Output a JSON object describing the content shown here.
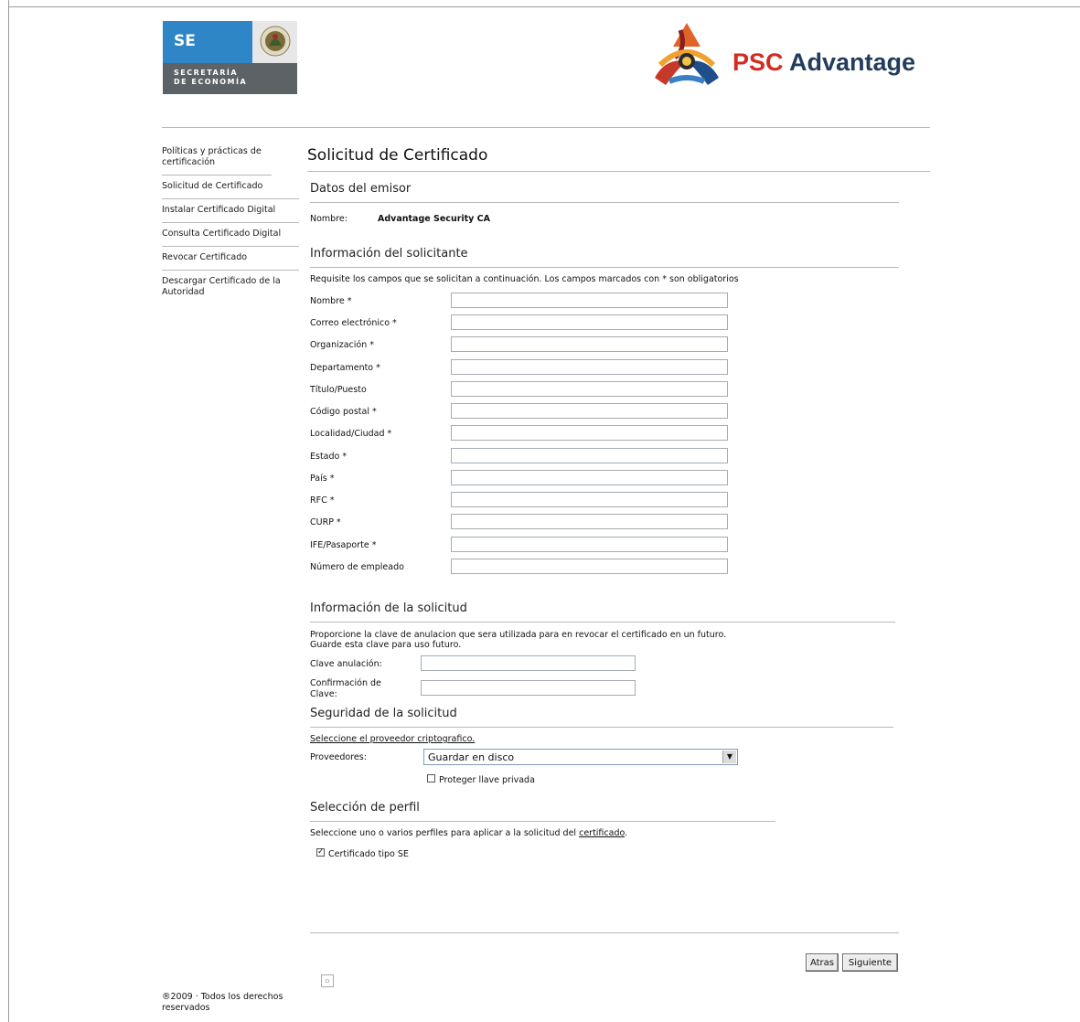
{
  "logos": {
    "se_abbr": "SE",
    "se_line1": "SECRETARÍA",
    "se_line2": "DE ECONOMÍA",
    "psc_part1": "PSC",
    "psc_part2": "Advantage"
  },
  "sidebar": {
    "items": [
      {
        "label": "Políticas y prácticas de certificación"
      },
      {
        "label": "Solicitud de Certificado"
      },
      {
        "label": "Instalar Certificado Digital"
      },
      {
        "label": "Consulta Certificado Digital"
      },
      {
        "label": "Revocar Certificado"
      },
      {
        "label": "Descargar Certificado de la Autoridad"
      }
    ]
  },
  "footer": {
    "copyright": "®2009 · Todos los derechos reservados"
  },
  "main": {
    "title": "Solicitud de Certificado",
    "emisor": {
      "heading": "Datos del emisor",
      "name_label": "Nombre:",
      "name_value": "Advantage Security CA"
    },
    "solicitante": {
      "heading": "Información del solicitante",
      "instructions": "Requisite los campos que se solicitan a continuación. Los campos marcados con * son obligatorios",
      "fields": [
        {
          "label": "Nombre *",
          "value": ""
        },
        {
          "label": "Correo electrónico *",
          "value": ""
        },
        {
          "label": "Organización *",
          "value": ""
        },
        {
          "label": "Departamento *",
          "value": ""
        },
        {
          "label": "Título/Puesto",
          "value": ""
        },
        {
          "label": "Código postal *",
          "value": ""
        },
        {
          "label": "Localidad/Ciudad *",
          "value": ""
        },
        {
          "label": "Estado *",
          "value": ""
        },
        {
          "label": "País *",
          "value": ""
        },
        {
          "label": "RFC *",
          "value": ""
        },
        {
          "label": "CURP *",
          "value": ""
        },
        {
          "label": "IFE/Pasaporte *",
          "value": ""
        },
        {
          "label": "Número de empleado",
          "value": ""
        }
      ]
    },
    "solicitud": {
      "heading": "Información de la solicitud",
      "instructions_line1": "Proporcione la clave de anulacion que sera utilizada para en revocar el certificado en un futuro.",
      "instructions_line2": "Guarde esta clave para uso futuro.",
      "clave_label": "Clave anulación:",
      "confirm_label_line1": "Confirmación de",
      "confirm_label_line2": "Clave:"
    },
    "seguridad": {
      "heading": "Seguridad de la solicitud",
      "link": "Seleccione el proveedor criptografico.",
      "providers_label": "Proveedores:",
      "providers_value": "Guardar en disco",
      "protect_label": "Proteger llave privada",
      "protect_checked": false
    },
    "perfil": {
      "heading": "Selección de perfil",
      "instructions_prefix": "Seleccione uno o varios perfiles para aplicar a la solicitud del ",
      "instructions_link": "certificado",
      "instructions_suffix": ".",
      "profile_label": "Certificado tipo SE",
      "profile_checked": true
    },
    "buttons": {
      "back": "Atras",
      "next": "Siguiente"
    }
  }
}
